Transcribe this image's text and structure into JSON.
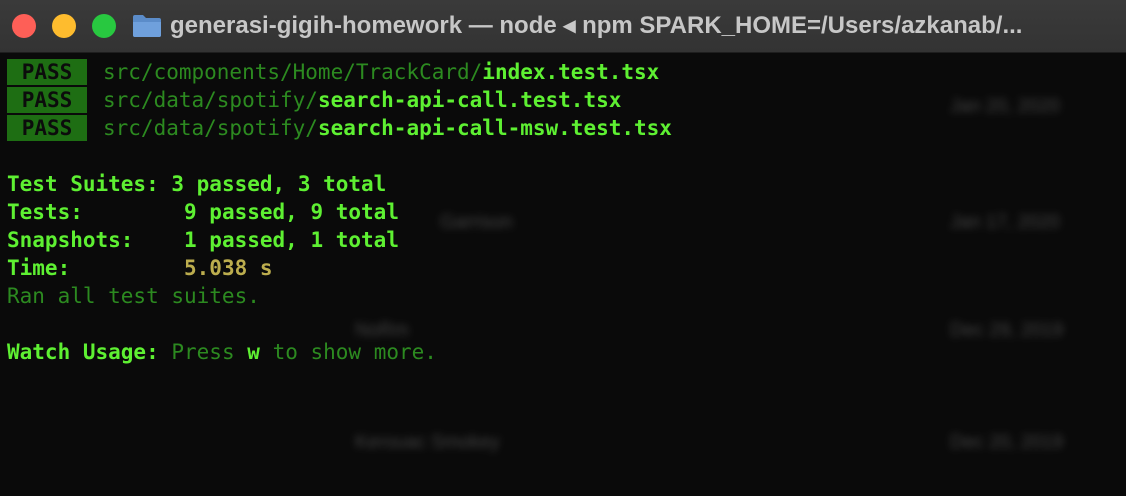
{
  "window": {
    "title": "generasi-gigih-homework — node ◂ npm SPARK_HOME=/Users/azkanab/..."
  },
  "traffic_lights": {
    "close_glyph": "×",
    "colors": {
      "close": "#fe5f57",
      "minimize": "#febc2e",
      "zoom": "#28c840"
    }
  },
  "colors": {
    "background": "#0a0a0a",
    "bright_green": "#5ef032",
    "dim_green": "#2c8a20",
    "pass_badge": "#1e6e13",
    "time_yellow": "#bcad4e"
  },
  "results": [
    {
      "badge": "PASS",
      "dir": "src/components/Home/TrackCard/",
      "file": "index.test.tsx"
    },
    {
      "badge": "PASS",
      "dir": "src/data/spotify/",
      "file": "search-api-call.test.tsx"
    },
    {
      "badge": "PASS",
      "dir": "src/data/spotify/",
      "file": "search-api-call-msw.test.tsx"
    }
  ],
  "summary": {
    "suites_label": "Test Suites:",
    "suites_passed": "3 passed,",
    "suites_total": "3 total",
    "tests_label": "Tests:",
    "tests_passed": "9 passed,",
    "tests_total": "9 total",
    "snapshots_label": "Snapshots:",
    "snapshots_passed": "1 passed,",
    "snapshots_total": "1 total",
    "time_label": "Time:",
    "time_value": "5.038 s",
    "ran_all": "Ran all test suites."
  },
  "watch": {
    "label": "Watch Usage:",
    "press": "Press",
    "key": "w",
    "rest": "to show more."
  },
  "background_window": {
    "rows": [
      {
        "name": "",
        "date": "Jan 20, 2020"
      },
      {
        "name": "Garrison",
        "date": "Jan 17, 2020"
      },
      {
        "name": "NoRm",
        "date": "Dec 29, 2019"
      },
      {
        "name": "Kerouac Smokey",
        "date": "Dec 20, 2019"
      }
    ]
  }
}
